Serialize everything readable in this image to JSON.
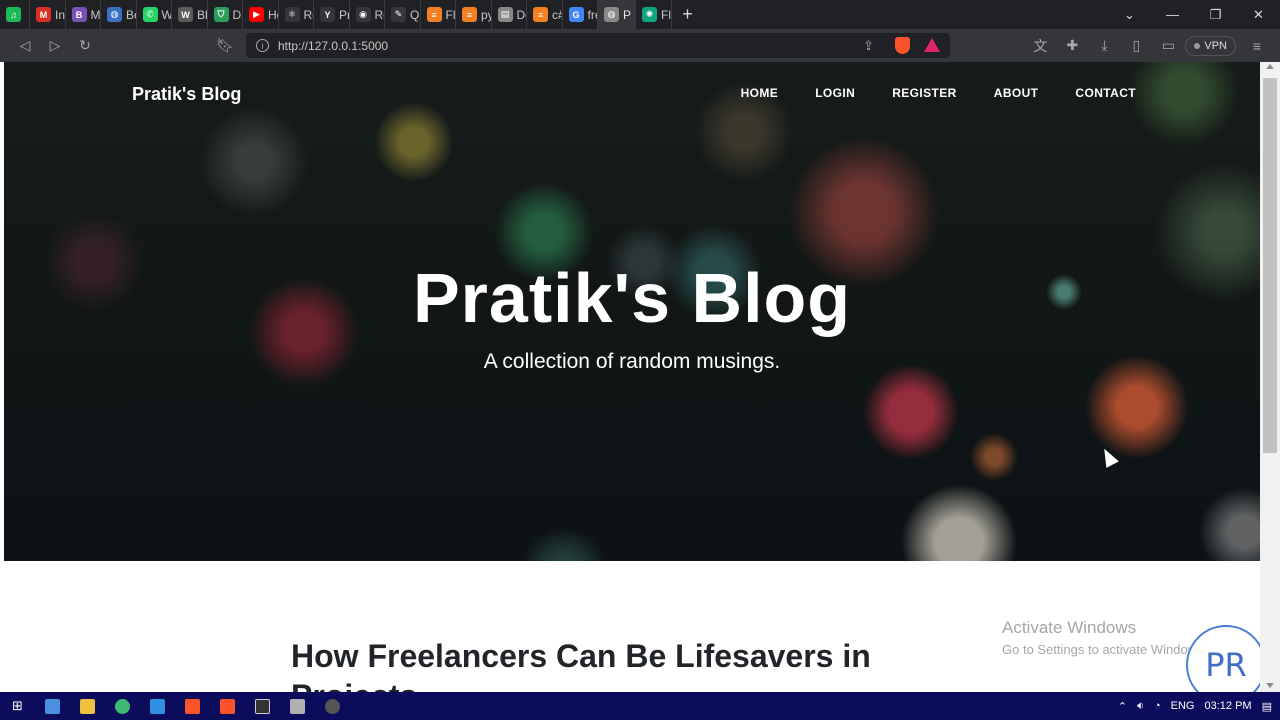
{
  "browser": {
    "tabs": [
      {
        "label": "",
        "icon": "spotify-icon",
        "color": "#1db954",
        "glyph": "♫"
      },
      {
        "label": "Inbo",
        "icon": "gmail-icon",
        "color": "#d93025",
        "glyph": "M"
      },
      {
        "label": "MyR",
        "icon": "bootstrap-icon",
        "color": "#7952b3",
        "glyph": "B"
      },
      {
        "label": "Beca",
        "icon": "globe-icon",
        "color": "#3a6fc4",
        "glyph": "◍"
      },
      {
        "label": "What",
        "icon": "whatsapp-icon",
        "color": "#25d366",
        "glyph": "✆"
      },
      {
        "label": "Blog",
        "icon": "wordpress-icon",
        "color": "#5c5c5c",
        "glyph": "W"
      },
      {
        "label": "DEVI",
        "icon": "shield-icon",
        "color": "#2e9e5e",
        "glyph": "⛉"
      },
      {
        "label": "How",
        "icon": "youtube-icon",
        "color": "#ff0000",
        "glyph": "▶"
      },
      {
        "label": "Reac",
        "icon": "react-icon",
        "color": "#35363a",
        "glyph": "⚛"
      },
      {
        "label": "Prati",
        "icon": "y-icon",
        "color": "#35363a",
        "glyph": "Y"
      },
      {
        "label": "Repo",
        "icon": "github-icon",
        "color": "#35363a",
        "glyph": "◉"
      },
      {
        "label": "Quicl",
        "icon": "feather-icon",
        "color": "#35363a",
        "glyph": "✎"
      },
      {
        "label": "Flask",
        "icon": "stackoverflow-icon",
        "color": "#f48024",
        "glyph": "≡"
      },
      {
        "label": "pyth",
        "icon": "stackoverflow-icon",
        "color": "#f48024",
        "glyph": "≡"
      },
      {
        "label": "Dow",
        "icon": "database-icon",
        "color": "#888888",
        "glyph": "▤"
      },
      {
        "label": "c# -",
        "icon": "stackoverflow-icon",
        "color": "#f48024",
        "glyph": "≡"
      },
      {
        "label": "freel",
        "icon": "google-icon",
        "color": "#4285f4",
        "glyph": "G"
      },
      {
        "label": "P",
        "icon": "page-icon",
        "color": "#888888",
        "glyph": "◍"
      },
      {
        "label": "Flexi",
        "icon": "chatgpt-icon",
        "color": "#10a37f",
        "glyph": "✺"
      }
    ],
    "active_tab_index": 17,
    "url": "http://127.0.0.1:5000",
    "vpn_label": "VPN"
  },
  "page": {
    "brand": "Pratik's Blog",
    "nav": [
      "HOME",
      "LOGIN",
      "REGISTER",
      "ABOUT",
      "CONTACT"
    ],
    "hero_title": "Pratik's Blog",
    "hero_subtitle": "A collection of random musings.",
    "post_title_line1": "How Freelancers Can Be Lifesavers in",
    "post_title_line2": "Projects"
  },
  "watermark": {
    "line1": "Activate Windows",
    "line2": "Go to Settings to activate Windows."
  },
  "logo_badge": "PR",
  "taskbar": {
    "language": "ENG",
    "time": "03:12 PM"
  }
}
